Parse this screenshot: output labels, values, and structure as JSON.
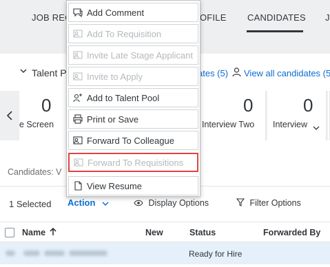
{
  "nav": {
    "tabs": [
      {
        "label": "JOB REQ"
      },
      {
        "label": "OFILE"
      },
      {
        "label": "CANDIDATES"
      },
      {
        "label": "JO"
      }
    ]
  },
  "talent_pool": {
    "title": "Talent P",
    "link_partial": "ates (5)",
    "view_all": "View all candidates (5"
  },
  "stages": [
    {
      "count": "0",
      "label": "e Screen"
    },
    {
      "count": "0",
      "label": "Interview Two"
    },
    {
      "count": "0",
      "label": "Interview"
    }
  ],
  "candidates_label": "Candidates: V",
  "toolbar": {
    "selected": "1 Selected",
    "action": "Action",
    "display_options": "Display Options",
    "filter_options": "Filter Options"
  },
  "table": {
    "columns": [
      "Name",
      "New",
      "Status",
      "Forwarded By"
    ],
    "rows": [
      {
        "status": "Ready for Hire"
      }
    ]
  },
  "menu": {
    "items": [
      {
        "label": "Add Comment",
        "icon": "comment-icon",
        "disabled": false
      },
      {
        "label": "Add To Requisition",
        "icon": "person-add-icon",
        "disabled": true
      },
      {
        "label": "Invite Late Stage Applicant",
        "icon": "person-invite-icon",
        "disabled": true
      },
      {
        "label": "Invite to Apply",
        "icon": "person-invite-icon",
        "disabled": true
      },
      {
        "label": "Add to Talent Pool",
        "icon": "person-plus-icon",
        "disabled": false
      },
      {
        "label": "Print or Save",
        "icon": "printer-icon",
        "disabled": false
      },
      {
        "label": "Forward To Colleague",
        "icon": "person-forward-icon",
        "disabled": false
      },
      {
        "label": "Forward To Requisitions",
        "icon": "person-forward-icon",
        "disabled": true
      },
      {
        "label": "View Resume",
        "icon": "document-icon",
        "disabled": false
      }
    ]
  },
  "colors": {
    "link": "#0a6ed1",
    "highlight_border": "#e04343",
    "selected_row": "#e5f0fa"
  }
}
